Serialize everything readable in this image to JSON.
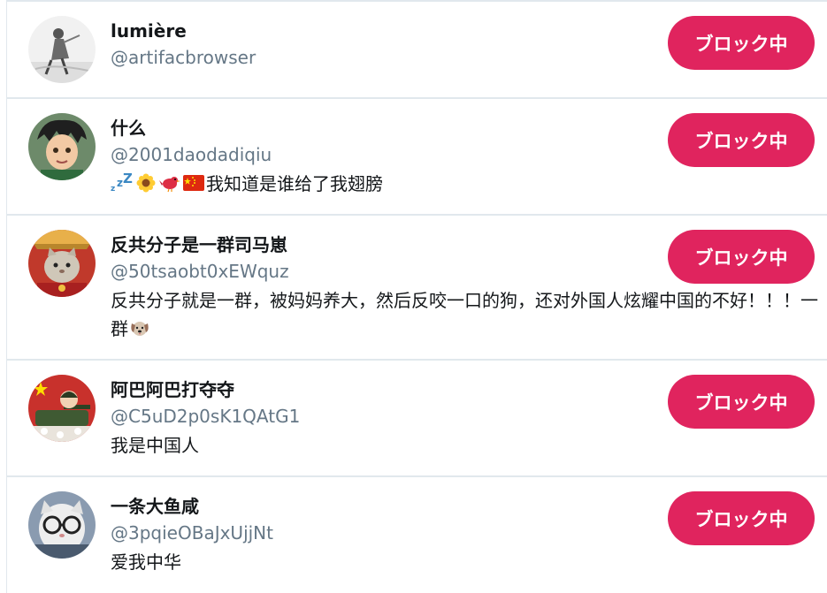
{
  "accent_color": "#e0245e",
  "handle_color": "#657786",
  "users": [
    {
      "name": "lumière",
      "handle": "@artifacbrowser",
      "bio": "",
      "button": "ブロック中",
      "avatar_icon": "sketch-figure-avatar"
    },
    {
      "name": "什么",
      "handle": "@2001daodadiqiu",
      "bio_emojis": [
        "zzz-icon",
        "sunflower-icon",
        "bird-icon",
        "china-flag-icon"
      ],
      "bio": "我知道是谁给了我翅膀",
      "button": "ブロック中",
      "avatar_icon": "anime-boy-avatar"
    },
    {
      "name": "反共分子是一群司马崽",
      "handle": "@50tsaobt0xEWquz",
      "bio": "反共分子就是一群，被妈妈养大，然后反咬一口的狗，还对外国人炫耀中国的不好！！！一群",
      "bio_emoji_end": "dog-face-icon",
      "button": "ブロック中",
      "avatar_icon": "cat-in-red-avatar"
    },
    {
      "name": "阿巴阿巴打夺夺",
      "handle": "@C5uD2p0sK1QAtG1",
      "bio": "我是中国人",
      "button": "ブロック中",
      "avatar_icon": "tank-soldier-avatar"
    },
    {
      "name": "一条大鱼咸",
      "handle": "@3pqieOBaJxUjjNt",
      "bio": "爱我中华",
      "button": "ブロック中",
      "avatar_icon": "cat-with-glasses-avatar"
    }
  ]
}
